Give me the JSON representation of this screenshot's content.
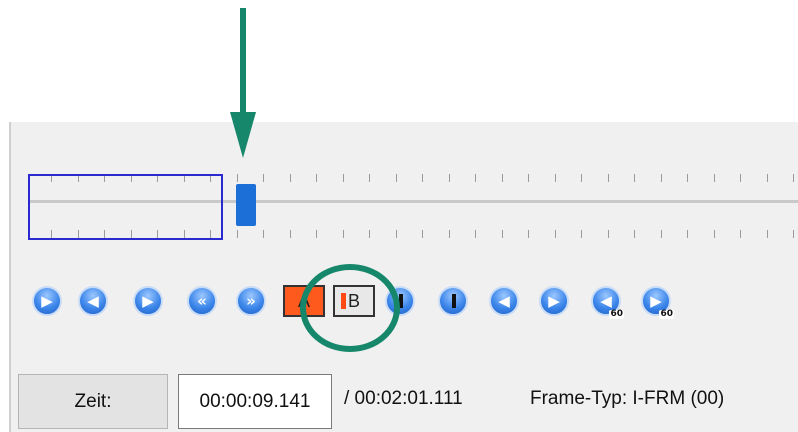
{
  "timeline": {
    "label": "position-slider"
  },
  "controls": {
    "play": "▶",
    "prev": "◀",
    "next": "▶",
    "rewind": "«",
    "forward": "»",
    "mark_a": "A",
    "mark_b": "B",
    "go_start": "◀",
    "go_end": "▶",
    "sub_60": "60"
  },
  "time_bar": {
    "zeit_label": "Zeit:",
    "current_time": "00:00:09.141",
    "total_time": "/ 00:02:01.111",
    "frame_type": "Frame-Typ:  I-FRM (00)"
  },
  "colors": {
    "accent": "#1b6fd6",
    "annotation": "#16876a",
    "marker_red": "#ff5a1e"
  }
}
